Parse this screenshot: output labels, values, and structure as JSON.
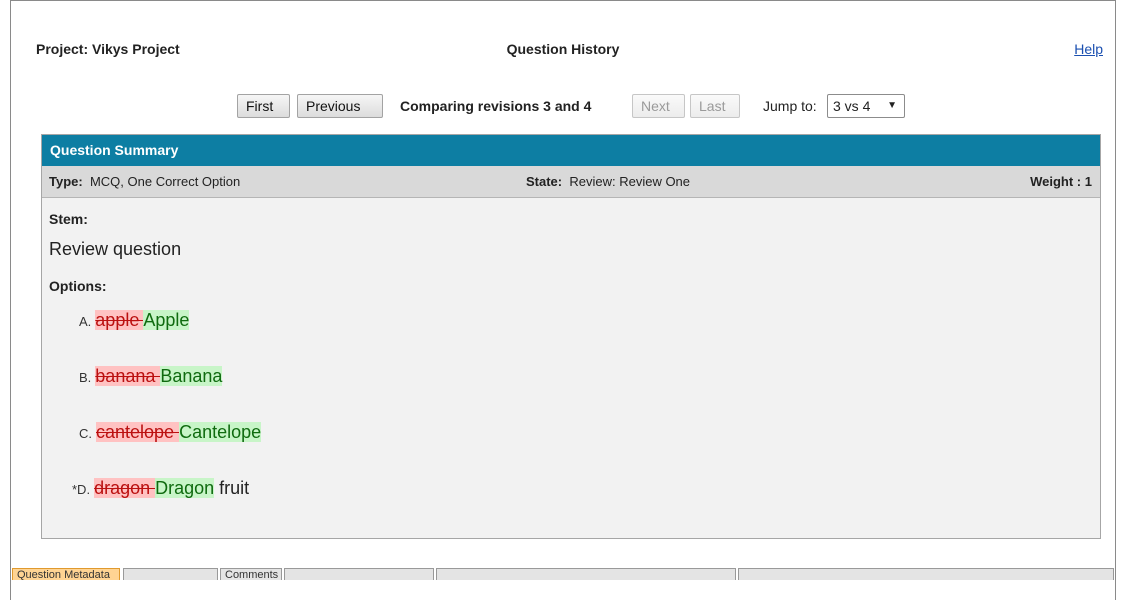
{
  "header": {
    "project": "Project: Vikys Project",
    "title": "Question History",
    "help": "Help"
  },
  "nav": {
    "first": "First",
    "previous": "Previous",
    "comparing": "Comparing revisions 3 and 4",
    "next": "Next",
    "last": "Last",
    "jump_label": "Jump to:",
    "jump_value": "3 vs 4",
    "jump_arrow": "▼"
  },
  "summary": {
    "title": "Question Summary",
    "type_label": "Type:",
    "type_value": "MCQ, One Correct Option",
    "state_label": "State:",
    "state_value": "Review: Review One",
    "weight_label": "Weight :",
    "weight_value": "1",
    "stem_label": "Stem:",
    "stem_text": "Review question",
    "options_label": "Options:",
    "options": [
      {
        "key": "A.",
        "removed": "apple ",
        "added": "Apple",
        "rest": ""
      },
      {
        "key": "B.",
        "removed": "banana ",
        "added": "Banana",
        "rest": ""
      },
      {
        "key": "C.",
        "removed": "cantelope ",
        "added": "Cantelope",
        "rest": ""
      },
      {
        "key": "*D.",
        "removed": "dragon ",
        "added": "Dragon",
        "rest": " fruit"
      }
    ]
  },
  "tabs": [
    "Question Metadata",
    "Comments",
    "",
    "",
    "",
    ""
  ]
}
